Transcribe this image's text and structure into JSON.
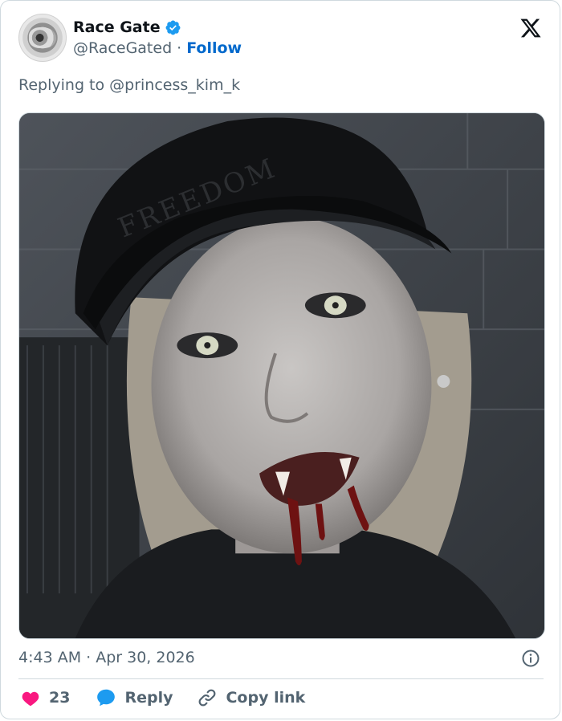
{
  "tweet": {
    "author_name": "Race Gate",
    "author_handle": "@RaceGated",
    "separator": "·",
    "follow_label": "Follow",
    "replying_to": "Replying to @princess_kim_k",
    "image_caption_text": "FREEDOM",
    "timestamp": "4:43 AM · Apr 30, 2026"
  },
  "actions": {
    "like_count": "23",
    "reply_label": "Reply",
    "copy_link_label": "Copy link"
  },
  "colors": {
    "like": "#f91880",
    "reply": "#1d9bf0",
    "follow": "#0069cc",
    "verified": "#1d9bf0",
    "muted_text": "#536471"
  },
  "icons": {
    "verified": "verified-badge-icon",
    "platform": "x-logo-icon",
    "info": "info-icon",
    "like": "heart-icon",
    "reply": "chat-bubble-icon",
    "copy_link": "link-icon"
  }
}
